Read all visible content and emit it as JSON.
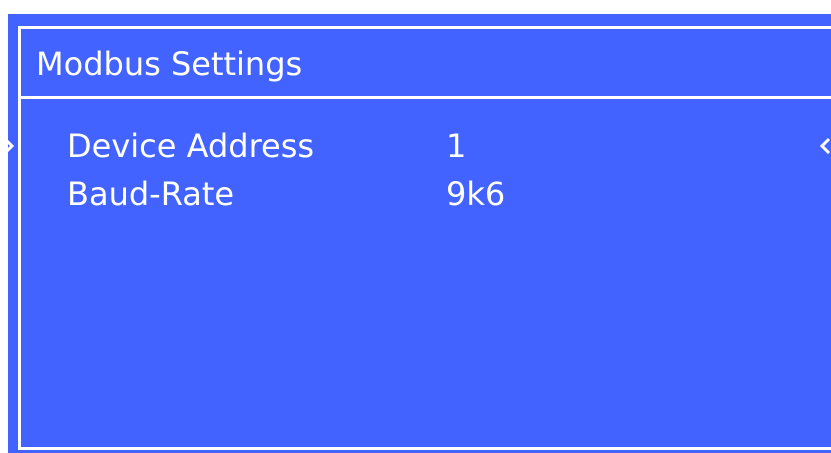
{
  "colors": {
    "background": "#4263ff",
    "foreground": "#ffffff"
  },
  "header": {
    "title": "Modbus Settings"
  },
  "menu": {
    "selected_index": 0,
    "items": [
      {
        "label": "Device Address",
        "value": "1"
      },
      {
        "label": "Baud-Rate",
        "value": "9k6"
      }
    ]
  },
  "icons": {
    "selection_left": "chevron-right-icon",
    "selection_right": "chevron-left-icon"
  }
}
